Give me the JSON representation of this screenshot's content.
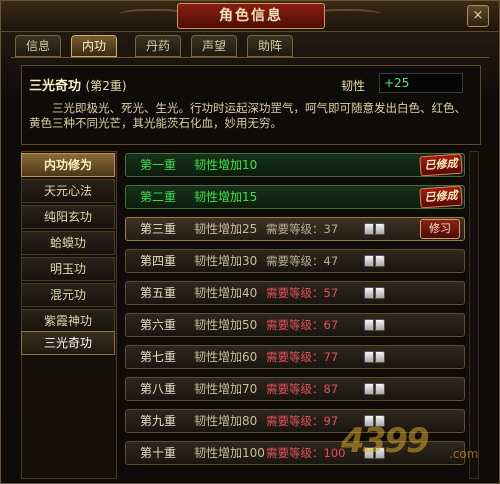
{
  "window": {
    "title": "角色信息",
    "close_label": "×"
  },
  "tabs": [
    {
      "label": "信息",
      "active": false
    },
    {
      "label": "内功",
      "active": true
    },
    {
      "label": "丹药",
      "active": false
    },
    {
      "label": "声望",
      "active": false
    },
    {
      "label": "助阵",
      "active": false
    }
  ],
  "skill": {
    "name": "三光奇功",
    "level_text": "(第2重)",
    "stat_label": "韧性",
    "stat_value": "+25",
    "description": "三光即极光、死光、生光。行功时运起深功罡气，呵气即可随意发出白色、红色、黄色三种不同光芒，其光能茨石化血，妙用无穷。"
  },
  "sidebar": {
    "header": "内功修为",
    "items": [
      "天元心法",
      "纯阳玄功",
      "蛤蟆功",
      "明玉功",
      "混元功",
      "紫霞神功",
      "三光奇功"
    ],
    "selected_index": 6
  },
  "levels": [
    {
      "name": "第一重",
      "bonus": "韧性增加10",
      "req": "",
      "state": "done",
      "badge": "已修成"
    },
    {
      "name": "第二重",
      "bonus": "韧性增加15",
      "req": "",
      "state": "done",
      "badge": "已修成"
    },
    {
      "name": "第三重",
      "bonus": "韧性增加25",
      "req": "需要等级：37",
      "state": "current",
      "button": "修习"
    },
    {
      "name": "第四重",
      "bonus": "韧性增加30",
      "req": "需要等级：47",
      "state": "available"
    },
    {
      "name": "第五重",
      "bonus": "韧性增加40",
      "req": "需要等级：57",
      "state": "locked"
    },
    {
      "name": "第六重",
      "bonus": "韧性增加50",
      "req": "需要等级：67",
      "state": "locked"
    },
    {
      "name": "第七重",
      "bonus": "韧性增加60",
      "req": "需要等级：77",
      "state": "locked"
    },
    {
      "name": "第八重",
      "bonus": "韧性增加70",
      "req": "需要等级：87",
      "state": "locked"
    },
    {
      "name": "第九重",
      "bonus": "韧性增加80",
      "req": "需要等级：97",
      "state": "locked"
    },
    {
      "name": "第十重",
      "bonus": "韧性增加100",
      "req": "需要等级：100",
      "state": "locked"
    }
  ],
  "watermark": {
    "number": "4399",
    "suffix": ".com"
  },
  "colors": {
    "accent_red": "#8a1e12",
    "done_green": "#3ee04c",
    "locked_red": "#e0505a",
    "gold": "#c79a52"
  }
}
